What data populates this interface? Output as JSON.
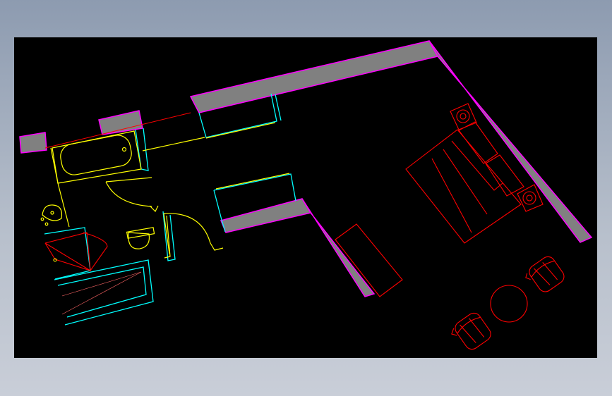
{
  "colors": {
    "wall_fill": "#808080",
    "wall_edge": "#ff00ff",
    "fixture": "#ffff00",
    "glass": "#00ffff",
    "furniture": "#ff0000",
    "viewport_bg": "#000000"
  },
  "layers": [
    "walls",
    "windows",
    "bathroom-fixtures",
    "furniture"
  ]
}
